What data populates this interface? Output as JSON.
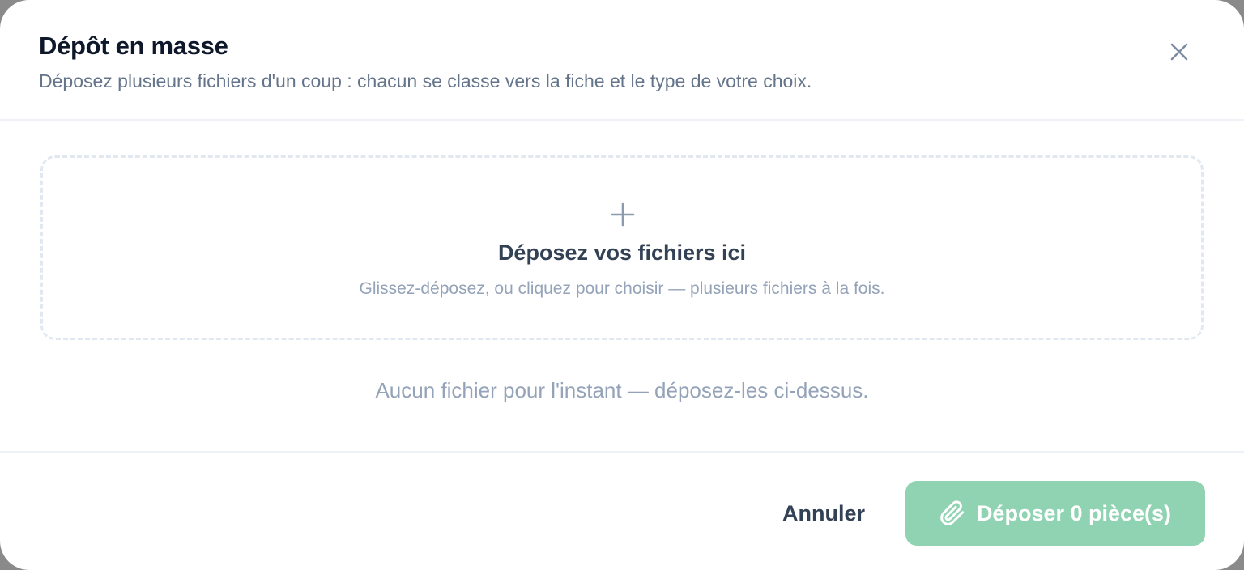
{
  "modal": {
    "title": "Dépôt en masse",
    "subtitle": "Déposez plusieurs fichiers d'un coup : chacun se classe vers la fiche et le type de votre choix.",
    "close_icon": "close-icon"
  },
  "dropzone": {
    "icon": "plus-icon",
    "title": "Déposez vos fichiers ici",
    "hint": "Glissez-déposez, ou cliquez pour choisir — plusieurs fichiers à la fois."
  },
  "file_list": {
    "empty_message": "Aucun fichier pour l'instant — déposez-les ci-dessus."
  },
  "footer": {
    "cancel_label": "Annuler",
    "submit_icon": "paperclip-icon",
    "submit_label": "Déposer 0 pièce(s)",
    "file_count": 0
  },
  "colors": {
    "title": "#0f172a",
    "subtitle": "#64748b",
    "muted": "#94a3b8",
    "submit_background_disabled": "#90d3b2",
    "dropzone_border": "#e2e8f0"
  }
}
